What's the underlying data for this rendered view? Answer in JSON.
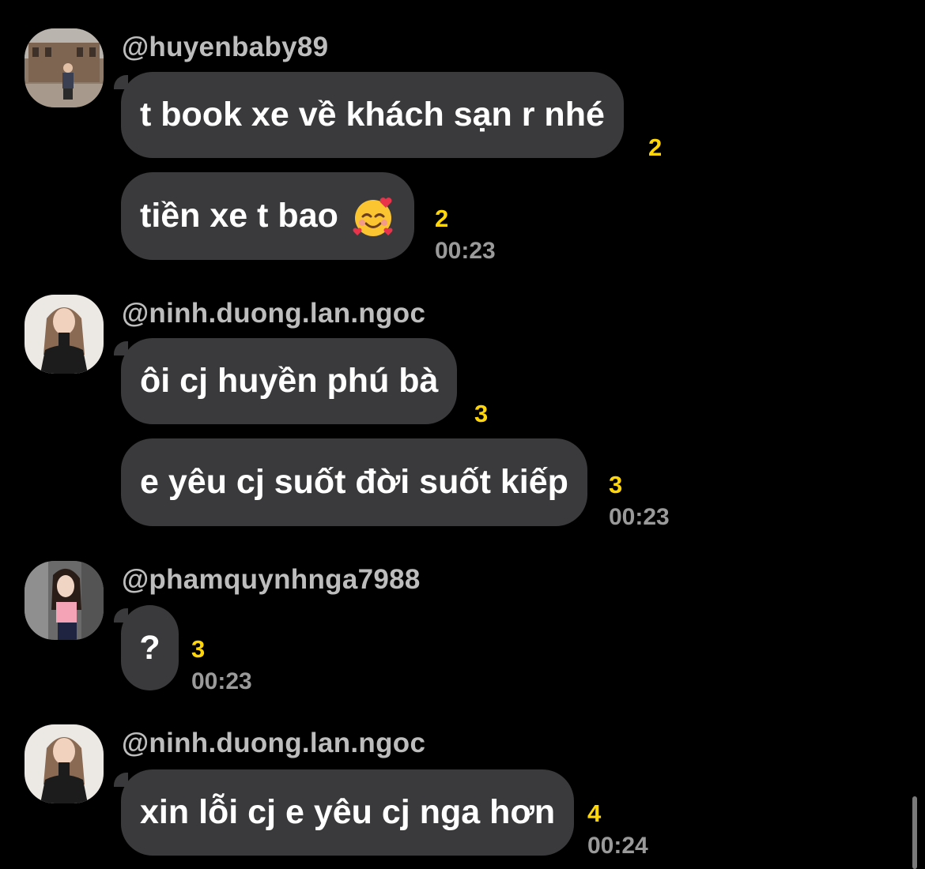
{
  "messages": [
    {
      "username": "@huyenbaby89",
      "avatar": "avatar-city-woman",
      "bubbles": [
        {
          "text": "t book xe về khách sạn r nhé",
          "count": "2"
        },
        {
          "text": "tiền xe t bao",
          "emoji": "smiling-face-with-hearts",
          "count": "2",
          "time": "00:23"
        }
      ]
    },
    {
      "username": "@ninh.duong.lan.ngoc",
      "avatar": "avatar-woman-black-top",
      "bubbles": [
        {
          "text": "ôi cj huyền phú bà",
          "count": "3"
        },
        {
          "text": "e yêu cj suốt đời suốt kiếp",
          "count": "3",
          "time": "00:23"
        }
      ]
    },
    {
      "username": "@phamquynhnga7988",
      "avatar": "avatar-woman-pink-top",
      "bubbles": [
        {
          "text": "?",
          "count": "3",
          "time": "00:23"
        }
      ]
    },
    {
      "username": "@ninh.duong.lan.ngoc",
      "avatar": "avatar-woman-black-top",
      "bubbles": [
        {
          "text": "xin lỗi cj e yêu cj nga hơn",
          "count": "4",
          "time": "00:24"
        }
      ]
    }
  ],
  "colors": {
    "background": "#000000",
    "bubble": "#3a3a3c",
    "count": "#ffd60a",
    "username": "#bdbdbd",
    "time": "#9a9a9a"
  }
}
